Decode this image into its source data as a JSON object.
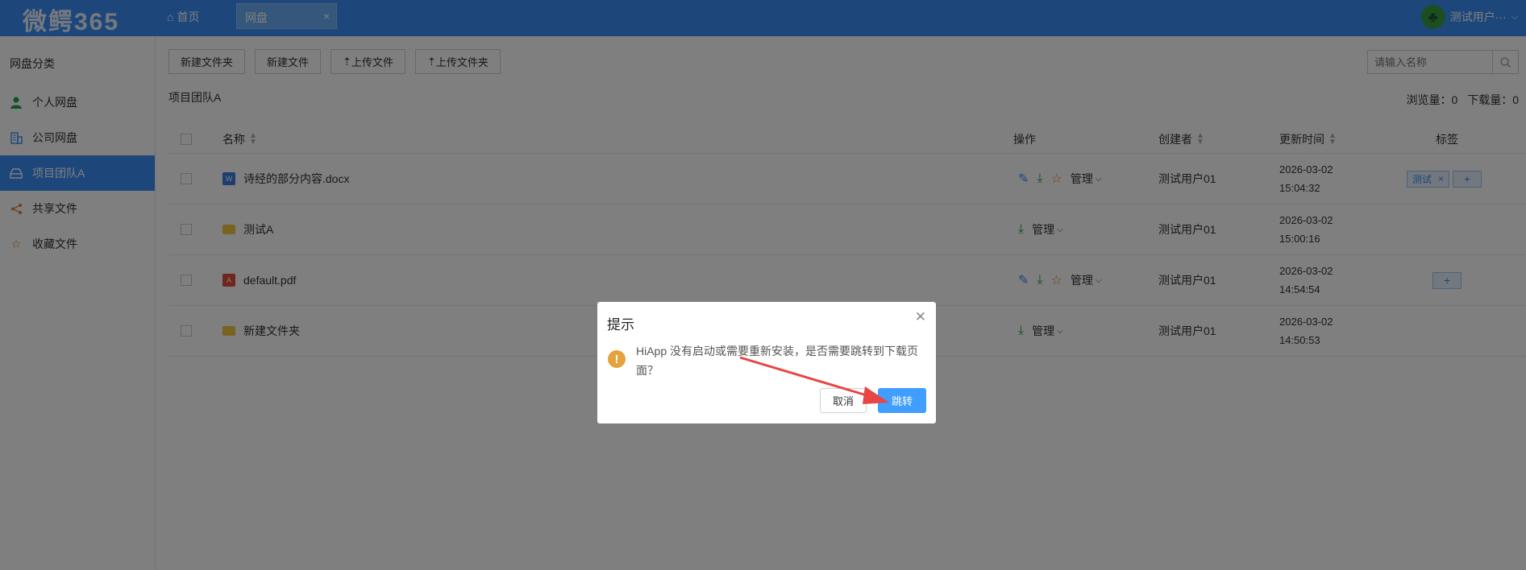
{
  "header": {
    "logo": "微鳄365",
    "home_label": "首页",
    "tab_label": "网盘",
    "tab_close": "×",
    "user_name": "测试用户···"
  },
  "sidebar": {
    "title": "网盘分类",
    "items": [
      {
        "label": "个人网盘",
        "icon": "user-icon"
      },
      {
        "label": "公司网盘",
        "icon": "building-icon"
      },
      {
        "label": "项目团队A",
        "icon": "drive-icon",
        "active": true
      },
      {
        "label": "共享文件",
        "icon": "share-icon"
      },
      {
        "label": "收藏文件",
        "icon": "star-icon"
      }
    ]
  },
  "toolbar": {
    "new_folder": "新建文件夹",
    "new_file": "新建文件",
    "upload_file": "上传文件",
    "upload_folder": "上传文件夹",
    "search_placeholder": "请输入名称"
  },
  "breadcrumb": "项目团队A",
  "stats": {
    "views_label": "浏览量：",
    "views": "0",
    "downloads_label": "下载量：",
    "downloads": "0"
  },
  "table": {
    "headers": {
      "name": "名称",
      "ops": "操作",
      "creator": "创建者",
      "updated": "更新时间",
      "tags": "标签"
    },
    "manage_label": "管理",
    "rows": [
      {
        "name": "诗经的部分内容.docx",
        "type": "docx",
        "creator": "测试用户01",
        "date": "2026-03-02",
        "time": "15:04:32",
        "tag": "测试"
      },
      {
        "name": "测试A",
        "type": "folder",
        "creator": "测试用户01",
        "date": "2026-03-02",
        "time": "15:00:16"
      },
      {
        "name": "default.pdf",
        "type": "pdf",
        "creator": "测试用户01",
        "date": "2026-03-02",
        "time": "14:54:54"
      },
      {
        "name": "新建文件夹",
        "type": "folder",
        "creator": "测试用户01",
        "date": "2026-03-02",
        "time": "14:50:53"
      }
    ]
  },
  "dialog": {
    "title": "提示",
    "message": "HiApp 没有启动或需要重新安装，是否需要跳转到下载页面？",
    "cancel": "取消",
    "confirm": "跳转"
  },
  "colors": {
    "primary": "#3b8ff6",
    "confirm": "#409eff",
    "warning": "#e6a23c",
    "arrow": "#e84545"
  }
}
